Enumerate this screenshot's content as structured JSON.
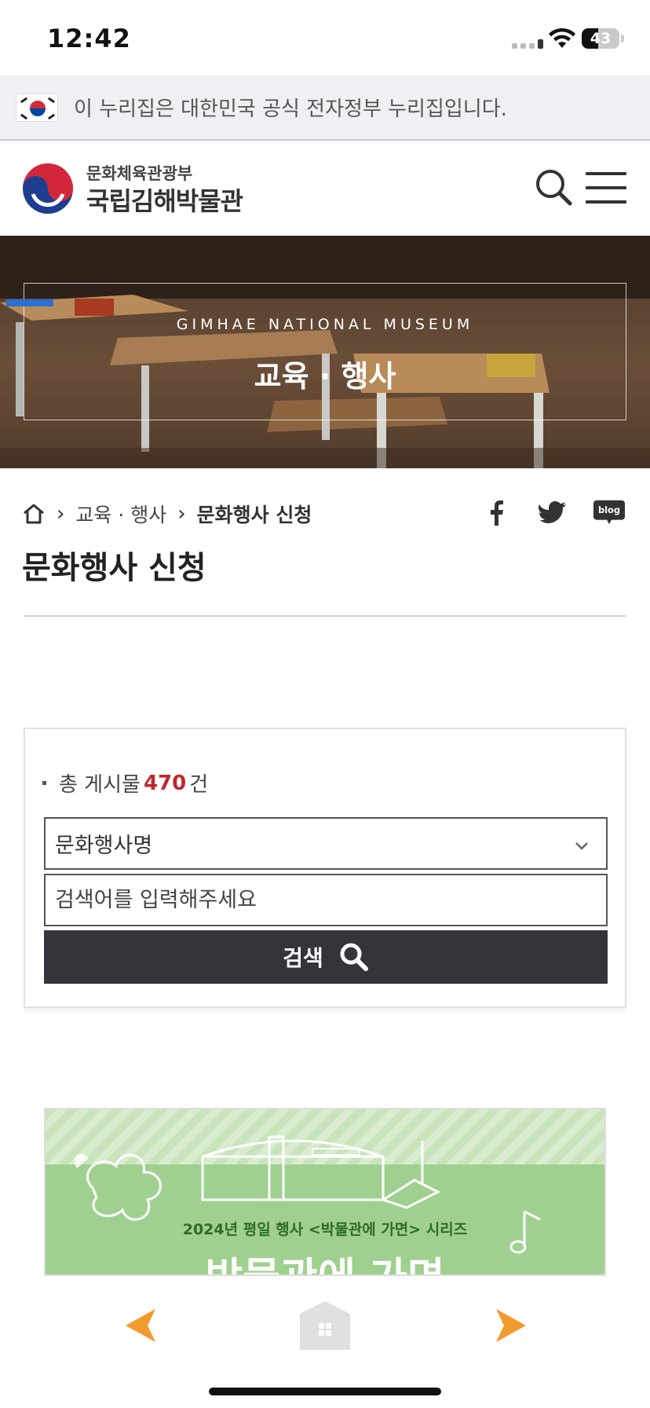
{
  "status_bar": {
    "time": "12:42",
    "battery": "43",
    "battery_level": 0.43
  },
  "gov_banner": {
    "text": "이 누리집은 대한민국 공식 전자정부 누리집입니다."
  },
  "header": {
    "ministry": "문화체육관광부",
    "museum": "국립김해박물관"
  },
  "hero": {
    "subtitle": "GIMHAE NATIONAL MUSEUM",
    "title": "교육 · 행사"
  },
  "breadcrumb": {
    "level1": "교육 · 행사",
    "level2": "문화행사 신청"
  },
  "page": {
    "title": "문화행사 신청"
  },
  "search": {
    "count_prefix": "총 게시물",
    "count": "470",
    "count_suffix": "건",
    "select_value": "문화행사명",
    "placeholder": "검색어를 입력해주세요",
    "submit_label": "검색"
  },
  "promo": {
    "subtitle": "2024년 평일 행사 <박물관에 가면> 시리즈",
    "title": "박물관에 가면"
  },
  "colors": {
    "accent_red": "#c0272d",
    "button_dark": "#33353a",
    "nav_orange": "#f39a2c",
    "hero_blue": "#2c6ed1"
  }
}
